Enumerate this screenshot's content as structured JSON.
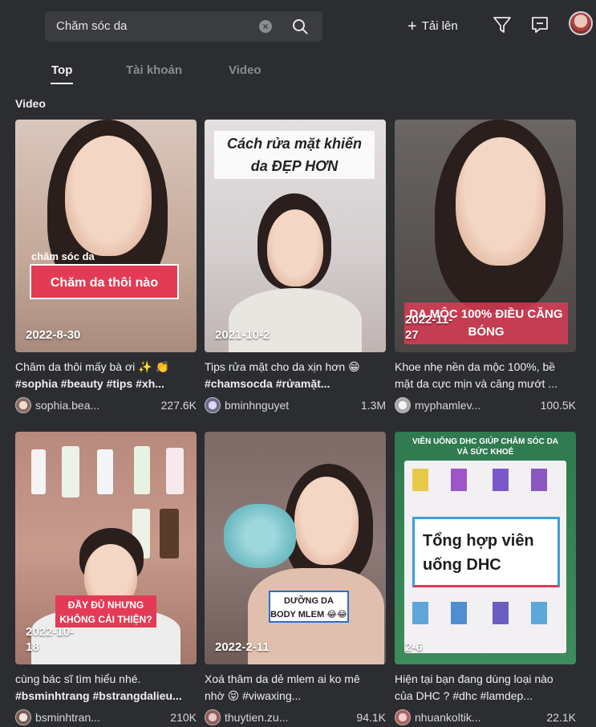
{
  "header": {
    "search_value": "Chăm sóc da",
    "clear_symbol": "×",
    "upload_label": "Tải lên",
    "upload_symbol": "+"
  },
  "tabs": [
    {
      "label": "Top"
    },
    {
      "label": "Tài khoản"
    },
    {
      "label": "Video"
    }
  ],
  "section_label": "Video",
  "videos": [
    {
      "date": "2022-8-30",
      "overlay_small": "chăm sóc da",
      "overlay_big": "Chăm da thôi nào",
      "desc_line1": "Chăm da thôi mấy bà ơi ✨ 👏",
      "desc_line2": "#sophia #beauty #tips #xh...",
      "author": "sophia.bea...",
      "views": "227.6K"
    },
    {
      "date": "2021-10-2",
      "overlay_big": "Cách rửa mặt khiến da ĐẸP HƠN",
      "desc_line1": "Tips rửa mặt cho da xịn hơn 😁",
      "desc_line2": "#chamsocda #rửamặt...",
      "author": "bminhnguyet",
      "views": "1.3M"
    },
    {
      "date": "2022-11-27",
      "overlay_big": "DA MỘC 100% ĐIỀU CĂNG BÓNG",
      "desc_line1": "Khoe nhẹ nền da mộc 100%, bề",
      "desc_line2": "mặt da cực mịn và căng mướt ...",
      "author": "myphamlev...",
      "views": "100.5K"
    },
    {
      "date": "2022-10-18",
      "overlay_big": "ĐẦY ĐỦ NHƯNG KHÔNG CẢI THIỆN?",
      "desc_line1": "cùng bác sĩ tìm hiểu nhé.",
      "desc_line2": "#bsminhtrang #bstrangdalieu...",
      "author": "bsminhtran...",
      "views": "210K"
    },
    {
      "date": "2022-2-11",
      "overlay_big": "DƯỠNG DA BODY MLEM 😂😂",
      "desc_line1": "Xoá thâm da dẻ mlem ai ko mê",
      "desc_line2": "nhờ 😝 #viwaxing...",
      "author": "thuytien.zu...",
      "views": "94.1K"
    },
    {
      "date": "2-6",
      "overlay_top": "VIÊN UỐNG DHC GIÚP CHĂM SÓC DA VÀ SỨC KHOẺ",
      "overlay_big": "Tổng hợp viên uống DHC",
      "desc_line1": "Hiện tại bạn đang dùng loại nào",
      "desc_line2": "của DHC ? #dhc #lamdep...",
      "author": "nhuankoltik...",
      "views": "22.1K"
    }
  ],
  "icons": {
    "search": "search-icon",
    "filter": "filter-icon",
    "inbox": "inbox-icon"
  },
  "colors": {
    "background": "#2b2d30",
    "accent_overlay": "#e33b55"
  }
}
